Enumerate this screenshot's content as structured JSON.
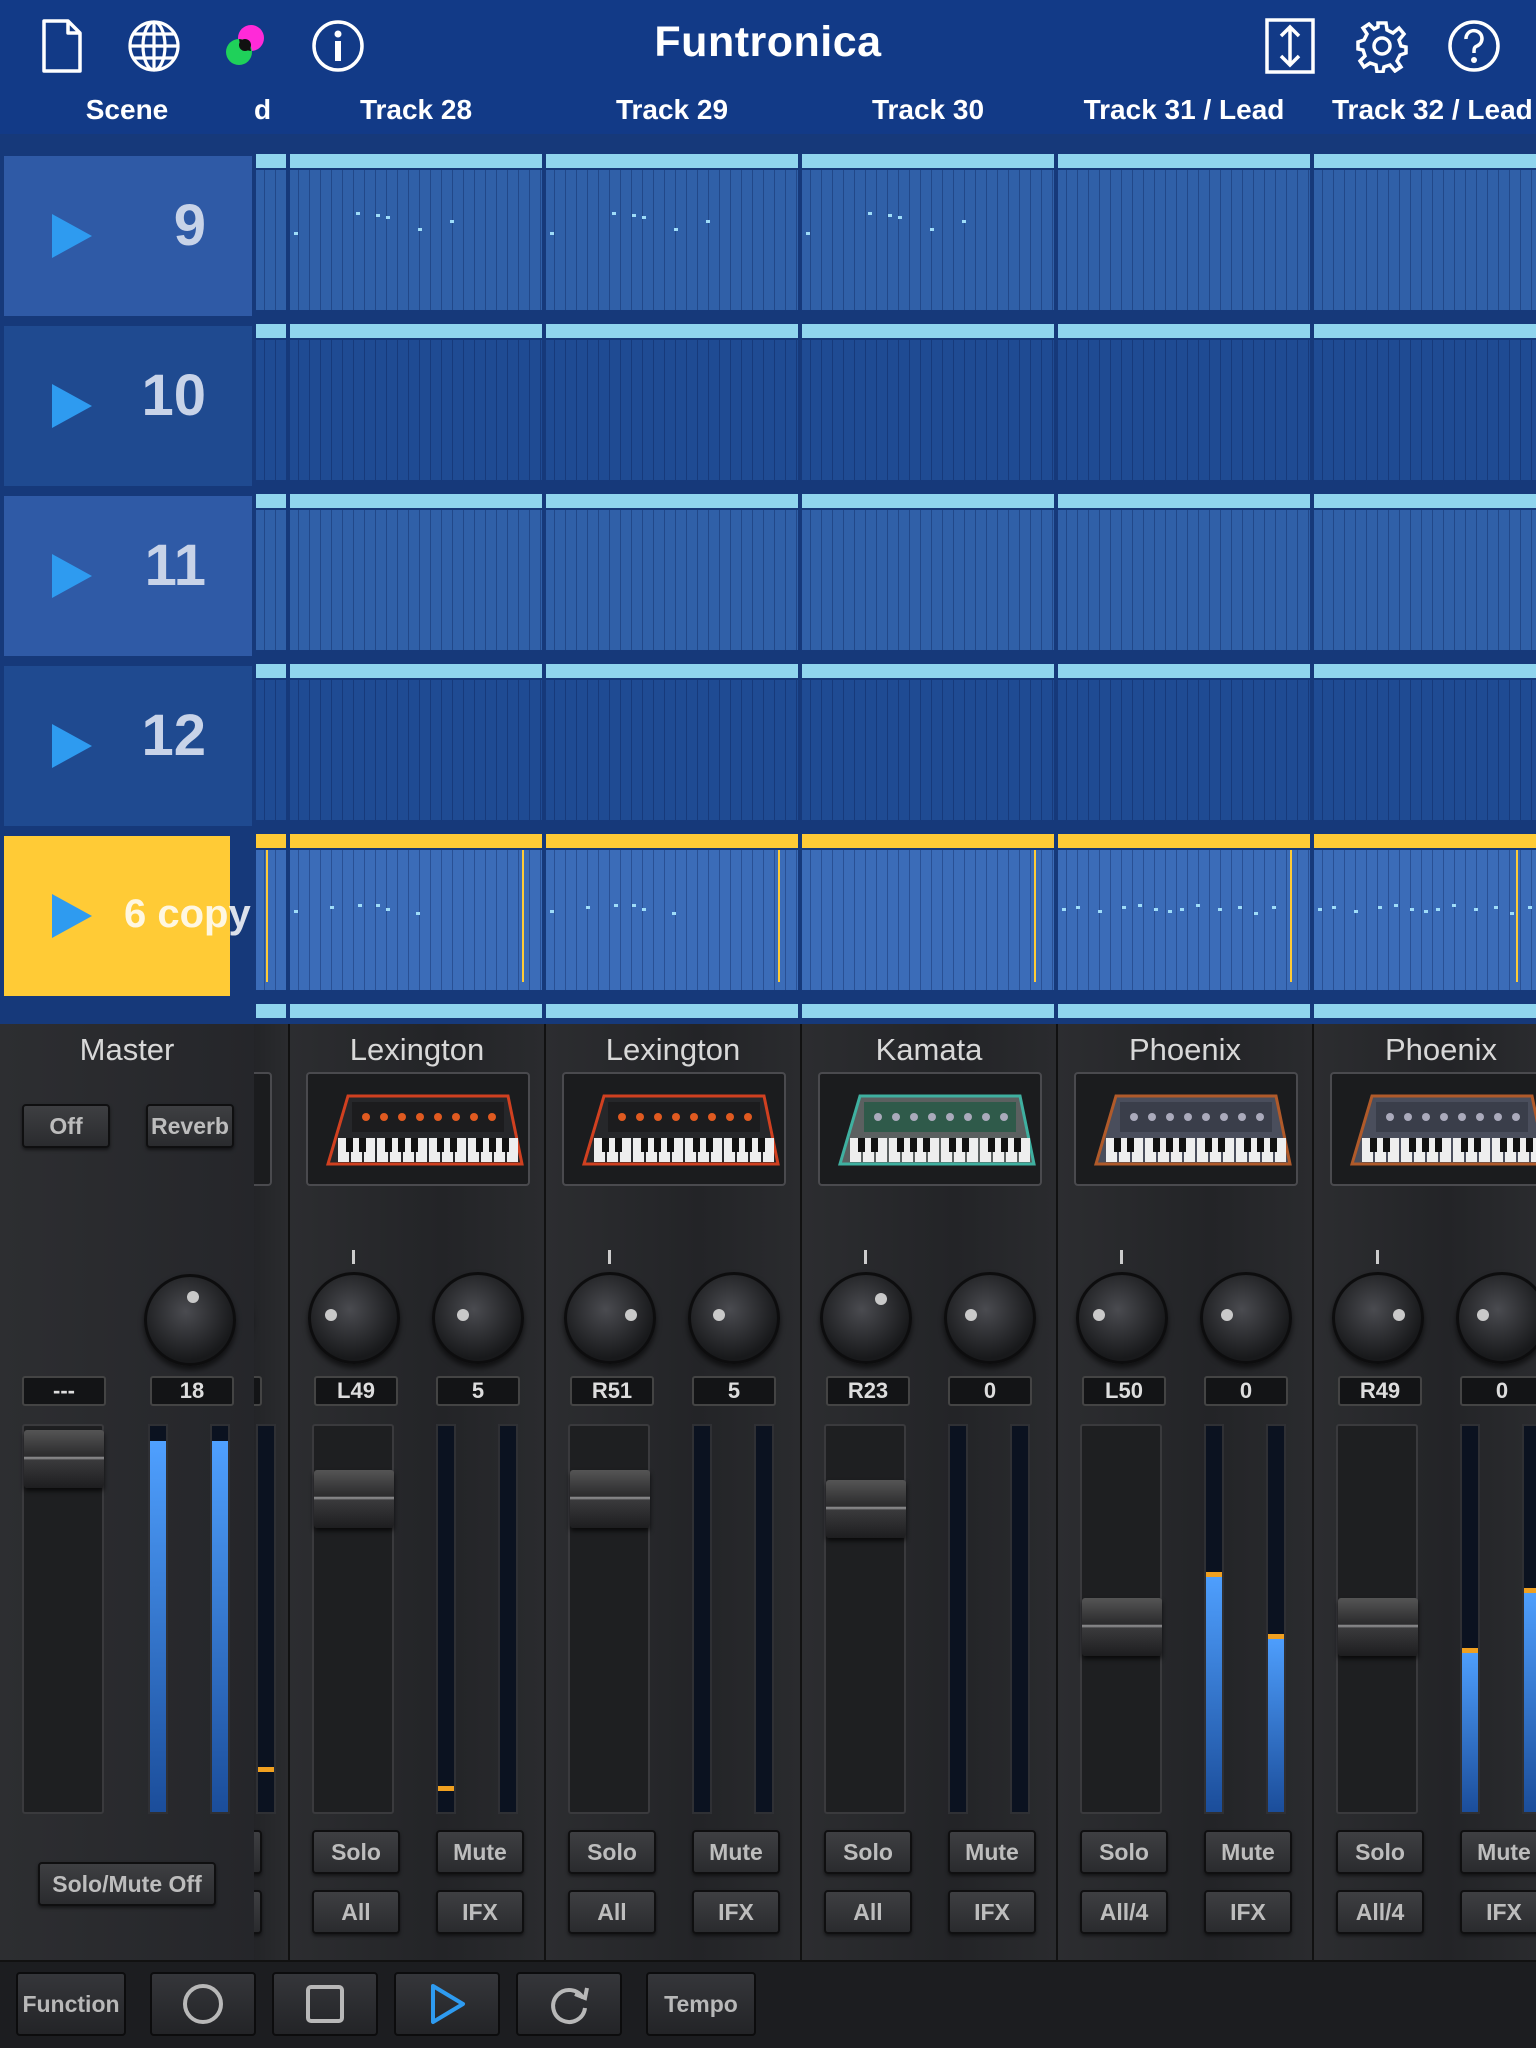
{
  "app": {
    "title": "Funtronica"
  },
  "toolbar": {
    "left_icons": [
      "new-file-icon",
      "globe-icon",
      "color-palette-icon",
      "info-icon"
    ],
    "right_icons": [
      "vertical-resize-icon",
      "gear-icon",
      "help-icon"
    ]
  },
  "header": {
    "scene_label": "Scene",
    "partial_track_label": "d",
    "tracks": [
      "Track 28",
      "Track 29",
      "Track 30",
      "Track 31 / Lead",
      "Track 32 / Lead"
    ]
  },
  "scenes": [
    {
      "label": "9",
      "selected": false
    },
    {
      "label": "10",
      "selected": false
    },
    {
      "label": "11",
      "selected": false
    },
    {
      "label": "12",
      "selected": false
    },
    {
      "label": "6 copy",
      "selected": true
    }
  ],
  "colors": {
    "accent_yellow": "#ffcb36",
    "play_blue": "#2e9bf0",
    "topbar": "#123a87",
    "clip_bar": "#90d5ee"
  },
  "mixer": {
    "master": {
      "label": "Master",
      "fx_off_label": "Off",
      "fx_reverb_label": "Reverb",
      "level_value": "---",
      "send_value": "18",
      "solo_mute_off_label": "Solo/Mute Off"
    },
    "channels": [
      {
        "name": "Lexington",
        "pan": "L49",
        "send": "5",
        "solo": "Solo",
        "mute": "Mute",
        "route": "All",
        "fx": "IFX"
      },
      {
        "name": "Lexington",
        "pan": "R51",
        "send": "5",
        "solo": "Solo",
        "mute": "Mute",
        "route": "All",
        "fx": "IFX"
      },
      {
        "name": "Kamata",
        "pan": "R23",
        "send": "0",
        "solo": "Solo",
        "mute": "Mute",
        "route": "All",
        "fx": "IFX"
      },
      {
        "name": "Phoenix",
        "pan": "L50",
        "send": "0",
        "solo": "Solo",
        "mute": "Mute",
        "route": "All/4",
        "fx": "IFX"
      },
      {
        "name": "Phoenix",
        "pan": "R49",
        "send": "0",
        "solo": "Solo",
        "mute": "Mute",
        "route": "All/4",
        "fx": "IFX"
      }
    ]
  },
  "transport": {
    "function_label": "Function",
    "tempo_label": "Tempo"
  }
}
